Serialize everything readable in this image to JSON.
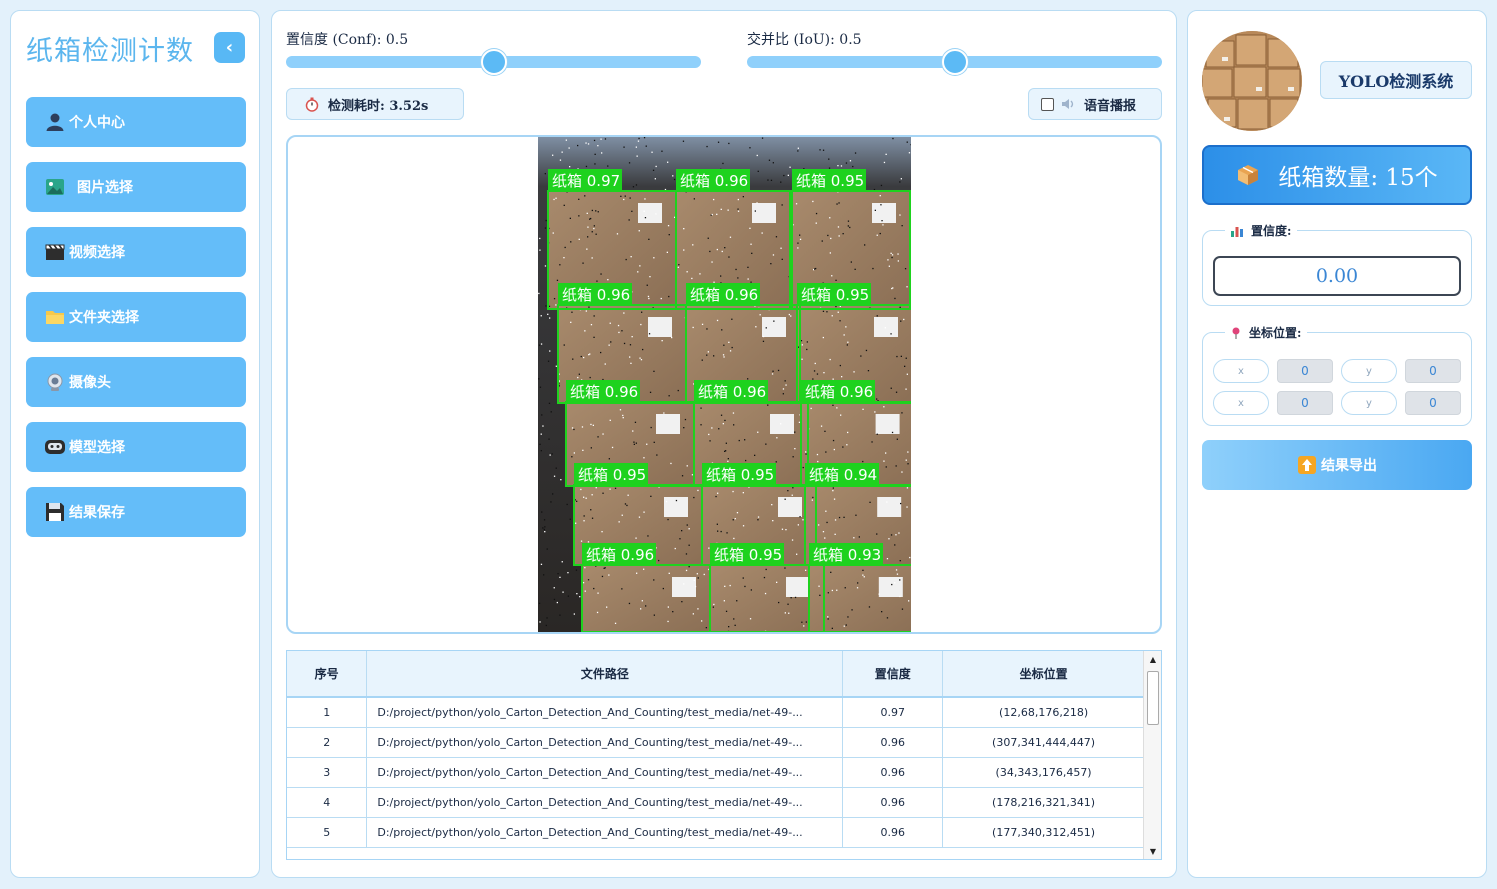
{
  "sidebar": {
    "title": "纸箱检测计数",
    "collapse_icon": "‹",
    "items": [
      {
        "label": "个人中心",
        "icon": "user-icon"
      },
      {
        "label": "图片选择",
        "icon": "image-icon"
      },
      {
        "label": "视频选择",
        "icon": "clapperboard-icon"
      },
      {
        "label": "文件夹选择",
        "icon": "folder-icon"
      },
      {
        "label": "摄像头",
        "icon": "camera-icon"
      },
      {
        "label": "模型选择",
        "icon": "model-icon"
      },
      {
        "label": "结果保存",
        "icon": "floppy-disk-icon"
      }
    ]
  },
  "controls": {
    "conf_label": "置信度 (Conf): 0.5",
    "conf_value": 0.5,
    "iou_label": "交并比 (IoU): 0.5",
    "iou_value": 0.5,
    "time_label": "检测耗时: 3.52s",
    "voice_label": "语音播报",
    "voice_checked": false
  },
  "detections": [
    {
      "label": "纸箱 0.97"
    },
    {
      "label": "纸箱 0.96"
    },
    {
      "label": "纸箱 0.95"
    },
    {
      "label": "纸箱 0.96"
    },
    {
      "label": "纸箱 0.96"
    },
    {
      "label": "纸箱 0.95"
    },
    {
      "label": "纸箱 0.96"
    },
    {
      "label": "纸箱 0.96"
    },
    {
      "label": "纸箱 0.96"
    },
    {
      "label": "纸箱 0.95"
    },
    {
      "label": "纸箱 0.95"
    },
    {
      "label": "纸箱 0.94"
    },
    {
      "label": "纸箱 0.96"
    },
    {
      "label": "纸箱 0.95"
    },
    {
      "label": "纸箱 0.93"
    }
  ],
  "table": {
    "headers": [
      "序号",
      "文件路径",
      "置信度",
      "坐标位置"
    ],
    "rows": [
      [
        "1",
        "D:/project/python/yolo_Carton_Detection_And_Counting/test_media/net-49-...",
        "0.97",
        "(12,68,176,218)"
      ],
      [
        "2",
        "D:/project/python/yolo_Carton_Detection_And_Counting/test_media/net-49-...",
        "0.96",
        "(307,341,444,447)"
      ],
      [
        "3",
        "D:/project/python/yolo_Carton_Detection_And_Counting/test_media/net-49-...",
        "0.96",
        "(34,343,176,457)"
      ],
      [
        "4",
        "D:/project/python/yolo_Carton_Detection_And_Counting/test_media/net-49-...",
        "0.96",
        "(178,216,321,341)"
      ],
      [
        "5",
        "D:/project/python/yolo_Carton_Detection_And_Counting/test_media/net-49-...",
        "0.96",
        "(177,340,312,451)"
      ]
    ]
  },
  "right": {
    "system_title": "YOLO检测系统",
    "count_label": "纸箱数量: 15个",
    "conf_group_title": "置信度:",
    "conf_value": "0.00",
    "coord_group_title": "坐标位置:",
    "coords": [
      {
        "label": "x",
        "value": "0"
      },
      {
        "label": "y",
        "value": "0"
      },
      {
        "label": "x",
        "value": "0"
      },
      {
        "label": "y",
        "value": "0"
      }
    ],
    "export_label": "结果导出"
  },
  "colors": {
    "accent": "#64bdf9",
    "detection_box": "#1ed21e",
    "count_box": "#2c8fe8"
  }
}
